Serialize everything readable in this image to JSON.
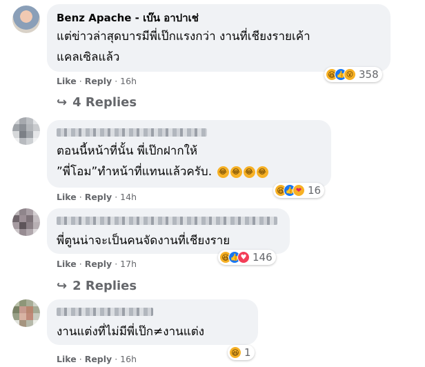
{
  "comments": [
    {
      "author": "Benz Apache - เบ๊น อาปาเช่",
      "lines": [
        "แต่ข่าวล่าสุดบารมีพี่เป๊กแรงกว่า งานที่เชียงรายเค้า",
        "แคลเซิลแล้ว"
      ],
      "like": "Like",
      "reply": "Reply",
      "time": "16h",
      "reactions": [
        "haha-icon",
        "like-icon",
        "wow-icon"
      ],
      "reaction_count": "358",
      "replies": "4 Replies"
    },
    {
      "lines": [
        "ตอนนี้หน้าที่นั้น พี่เป๊กฝากให้",
        "”พี่โอม”ทำหน้าที่แทนแล้วครับ."
      ],
      "like": "Like",
      "reply": "Reply",
      "time": "14h",
      "reactions": [
        "haha-icon",
        "like-icon",
        "care-icon"
      ],
      "reaction_count": "16"
    },
    {
      "lines": [
        "พี่ตูนน่าจะเป็นคนจัดงานที่เชียงราย"
      ],
      "like": "Like",
      "reply": "Reply",
      "time": "17h",
      "reactions": [
        "haha-icon",
        "like-icon",
        "love-icon"
      ],
      "reaction_count": "146",
      "replies": "2 Replies"
    },
    {
      "lines": [
        "งานแต่งที่ไม่มีพี่เป๊ก≠งานแต่ง"
      ],
      "like": "Like",
      "reply": "Reply",
      "time": "16h",
      "reactions": [
        "haha-icon"
      ],
      "reaction_count": "1"
    }
  ],
  "separator": "·",
  "reply_arrow": "↪",
  "colors": {
    "bubble": "#f0f2f5",
    "meta": "#65676b",
    "like_blue": "#1877f2",
    "haha_yellow": "#f7b125",
    "love_red": "#f33e58"
  }
}
